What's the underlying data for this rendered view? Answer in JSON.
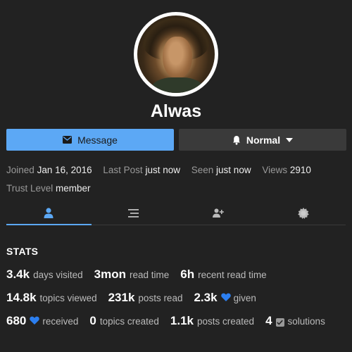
{
  "user": {
    "username": "Alwas"
  },
  "actions": {
    "message_label": "Message",
    "notification_label": "Normal"
  },
  "meta": {
    "joined_label": "Joined",
    "joined_value": "Jan 16, 2016",
    "last_post_label": "Last Post",
    "last_post_value": "just now",
    "seen_label": "Seen",
    "seen_value": "just now",
    "views_label": "Views",
    "views_value": "2910",
    "trust_label": "Trust Level",
    "trust_value": "member"
  },
  "tabs": [
    {
      "icon": "user-icon",
      "active": true
    },
    {
      "icon": "list-icon",
      "active": false
    },
    {
      "icon": "user-plus-icon",
      "active": false
    },
    {
      "icon": "badge-icon",
      "active": false
    }
  ],
  "stats": {
    "title": "STATS",
    "days_visited": {
      "value": "3.4k",
      "label": "days visited"
    },
    "read_time": {
      "value": "3mon",
      "label": "read time"
    },
    "recent_read_time": {
      "value": "6h",
      "label": "recent read time"
    },
    "topics_viewed": {
      "value": "14.8k",
      "label": "topics viewed"
    },
    "posts_read": {
      "value": "231k",
      "label": "posts read"
    },
    "likes_given": {
      "value": "2.3k",
      "label": "given"
    },
    "likes_received": {
      "value": "680",
      "label": "received"
    },
    "topics_created": {
      "value": "0",
      "label": "topics created"
    },
    "posts_created": {
      "value": "1.1k",
      "label": "posts created"
    },
    "solutions": {
      "value": "4",
      "label": "solutions"
    }
  },
  "colors": {
    "background": "#222222",
    "accent": "#5ca8f5",
    "heart": "#2c7ff0"
  }
}
